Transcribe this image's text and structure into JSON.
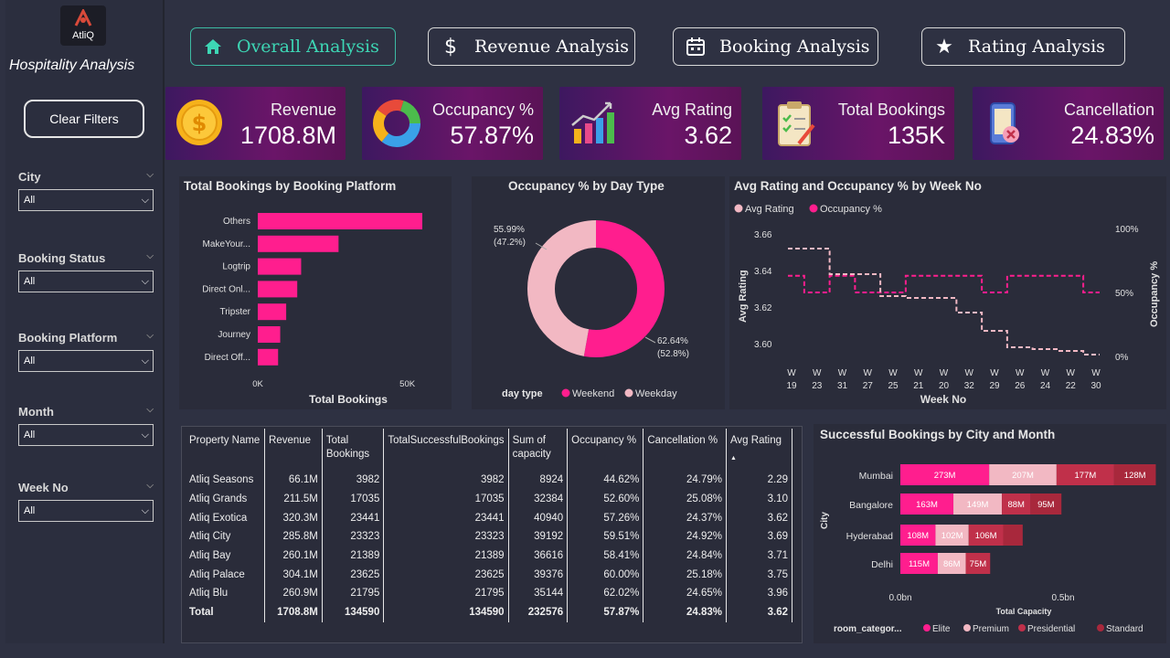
{
  "app": {
    "logo_text": "AtliQ",
    "title": "Hospitality Analysis"
  },
  "nav": [
    {
      "label": "Overall Analysis",
      "icon": "home-icon",
      "active": true
    },
    {
      "label": "Revenue Analysis",
      "icon": "dollar-icon",
      "active": false
    },
    {
      "label": "Booking Analysis",
      "icon": "calendar-icon",
      "active": false
    },
    {
      "label": "Rating Analysis",
      "icon": "star-icon",
      "active": false
    }
  ],
  "sidebar": {
    "clear_filters": "Clear Filters",
    "filters": [
      {
        "label": "City",
        "value": "All"
      },
      {
        "label": "Booking Status",
        "value": "All"
      },
      {
        "label": "Booking Platform",
        "value": "All"
      },
      {
        "label": "Month",
        "value": "All"
      },
      {
        "label": "Week No",
        "value": "All"
      }
    ]
  },
  "kpis": [
    {
      "title": "Revenue",
      "value": "1708.8M",
      "icon": "coin-icon"
    },
    {
      "title": "Occupancy %",
      "value": "57.87%",
      "icon": "donut-icon"
    },
    {
      "title": "Avg Rating",
      "value": "3.62",
      "icon": "growth-chart-icon"
    },
    {
      "title": "Total Bookings",
      "value": "135K",
      "icon": "clipboard-icon"
    },
    {
      "title": "Cancellation",
      "value": "24.83%",
      "icon": "mobile-cancel-icon"
    }
  ],
  "colors": {
    "accent": "#ff1e8e",
    "light_pink": "#f2b8c3",
    "dark_red": "#c0304a",
    "darker_red": "#a8283c",
    "teal": "#3dd6b4",
    "bg": "#2e3142",
    "panel": "#2a2c3a"
  },
  "chart_data": [
    {
      "type": "bar",
      "title": "Total Bookings by Booking Platform",
      "xlabel": "Total Bookings",
      "categories": [
        "Others",
        "MakeYour...",
        "Logtrip",
        "Direct Onl...",
        "Tripster",
        "Journey",
        "Direct Off..."
      ],
      "values": [
        55000,
        27000,
        14500,
        13200,
        9500,
        7500,
        6800
      ],
      "xlim": [
        0,
        55000
      ],
      "x_ticks": [
        "0K",
        "50K"
      ]
    },
    {
      "type": "pie",
      "title": "Occupancy % by Day Type",
      "legend_title": "day type",
      "slices": [
        {
          "name": "Weekend",
          "value": 52.8,
          "label": "62.64%",
          "pct_label": "(52.8%)"
        },
        {
          "name": "Weekday",
          "value": 47.2,
          "label": "55.99%",
          "pct_label": "(47.2%)"
        }
      ]
    },
    {
      "type": "line",
      "title": "Avg Rating and Occupancy % by Week No",
      "xlabel": "Week No",
      "ylabel": "Avg Rating",
      "y2label": "Occupancy %",
      "legend": [
        "Avg Rating",
        "Occupancy %"
      ],
      "x": [
        "W 19",
        "W 23",
        "W 31",
        "W 27",
        "W 25",
        "W 21",
        "W 20",
        "W 32",
        "W 29",
        "W 26",
        "W 24",
        "W 22",
        "W 30"
      ],
      "y_ticks": [
        "3.66",
        "3.64",
        "3.62",
        "3.60"
      ],
      "y2_ticks": [
        "100%",
        "50%",
        "0%"
      ],
      "ylim": [
        3.59,
        3.665
      ],
      "y2lim": [
        0,
        100
      ],
      "series": [
        {
          "name": "Avg Rating",
          "values": [
            3.652,
            3.652,
            3.638,
            3.638,
            3.626,
            3.625,
            3.625,
            3.617,
            3.607,
            3.598,
            3.597,
            3.596,
            3.594
          ]
        },
        {
          "name": "Occupancy %",
          "values": [
            63,
            50,
            63,
            50,
            50,
            63,
            63,
            63,
            50,
            63,
            63,
            63,
            50
          ]
        }
      ]
    },
    {
      "type": "bar",
      "title": "Successful Bookings by City and Month",
      "xlabel": "Total Capacity",
      "ylabel": "City",
      "legend_title": "room_categor...",
      "categories": [
        "Mumbai",
        "Bangalore",
        "Hyderabad",
        "Delhi"
      ],
      "x_ticks": [
        "0.0bn",
        "0.5bn"
      ],
      "xlim": [
        0,
        0.75
      ],
      "series": [
        {
          "name": "Elite",
          "values": [
            0.273,
            0.163,
            0.108,
            0.115
          ],
          "labels": [
            "273M",
            "163M",
            "108M",
            "115M"
          ]
        },
        {
          "name": "Premium",
          "values": [
            0.207,
            0.149,
            0.102,
            0.086
          ],
          "labels": [
            "207M",
            "149M",
            "102M",
            "86M"
          ]
        },
        {
          "name": "Presidential",
          "values": [
            0.177,
            0.088,
            0.106,
            0.075
          ],
          "labels": [
            "177M",
            "88M",
            "106M",
            "75M"
          ]
        },
        {
          "name": "Standard",
          "values": [
            0.128,
            0.095,
            0.06,
            0
          ],
          "labels": [
            "128M",
            "95M",
            "",
            ""
          ]
        }
      ]
    },
    {
      "type": "table",
      "columns": [
        "Property Name",
        "Revenue",
        "Total Bookings",
        "TotalSuccessfulBookings",
        "Sum of capacity",
        "Occupancy %",
        "Cancellation %",
        "Avg Rating"
      ],
      "rows": [
        [
          "Atliq Seasons",
          "66.1M",
          "3982",
          "3982",
          "8924",
          "44.62%",
          "24.79%",
          "2.29"
        ],
        [
          "Atliq Grands",
          "211.5M",
          "17035",
          "17035",
          "32384",
          "52.60%",
          "25.08%",
          "3.10"
        ],
        [
          "Atliq Exotica",
          "320.3M",
          "23441",
          "23441",
          "40940",
          "57.26%",
          "24.37%",
          "3.62"
        ],
        [
          "Atliq City",
          "285.8M",
          "23323",
          "23323",
          "39192",
          "59.51%",
          "24.92%",
          "3.69"
        ],
        [
          "Atliq Bay",
          "260.1M",
          "21389",
          "21389",
          "36616",
          "58.41%",
          "24.84%",
          "3.71"
        ],
        [
          "Atliq Palace",
          "304.1M",
          "23625",
          "23625",
          "39376",
          "60.00%",
          "25.18%",
          "3.75"
        ],
        [
          "Atliq Blu",
          "260.9M",
          "21795",
          "21795",
          "35144",
          "62.02%",
          "24.65%",
          "3.96"
        ]
      ],
      "total": [
        "Total",
        "1708.8M",
        "134590",
        "134590",
        "232576",
        "57.87%",
        "24.83%",
        "3.62"
      ]
    }
  ]
}
